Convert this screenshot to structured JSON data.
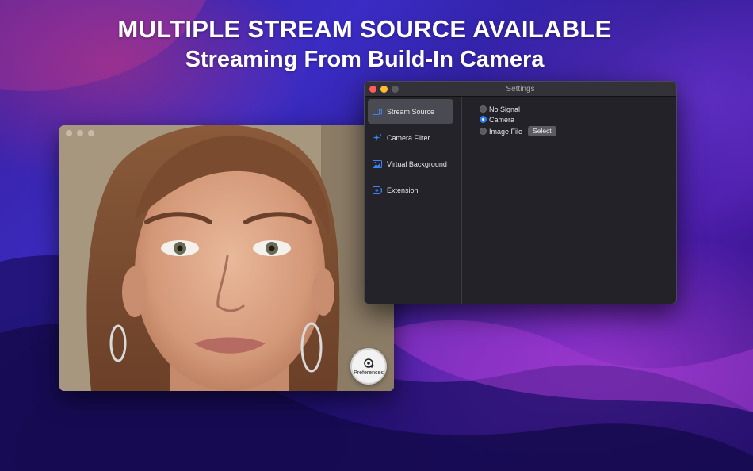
{
  "headline": {
    "line1": "MULTIPLE STREAM SOURCE AVAILABLE",
    "line2": "Streaming From Build-In Camera"
  },
  "camera_window": {
    "preferences_label": "Preferences",
    "preferences_icon": "preferences-gear-icon"
  },
  "settings_window": {
    "title": "Settings",
    "sidebar": [
      {
        "label": "Stream Source",
        "icon": "camera-icon",
        "active": true
      },
      {
        "label": "Camera Filter",
        "icon": "sparkle-icon",
        "active": false
      },
      {
        "label": "Virtual Background",
        "icon": "image-icon",
        "active": false
      },
      {
        "label": "Extension",
        "icon": "extension-icon",
        "active": false
      }
    ],
    "stream_source": {
      "options": [
        {
          "label": "No Signal",
          "selected": false
        },
        {
          "label": "Camera",
          "selected": true
        },
        {
          "label": "Image File",
          "selected": false
        }
      ],
      "select_button": "Select"
    }
  },
  "colors": {
    "accent": "#2f7cf6",
    "close": "#ff5f57",
    "minimize": "#febc2e",
    "window_bg": "#232228"
  }
}
